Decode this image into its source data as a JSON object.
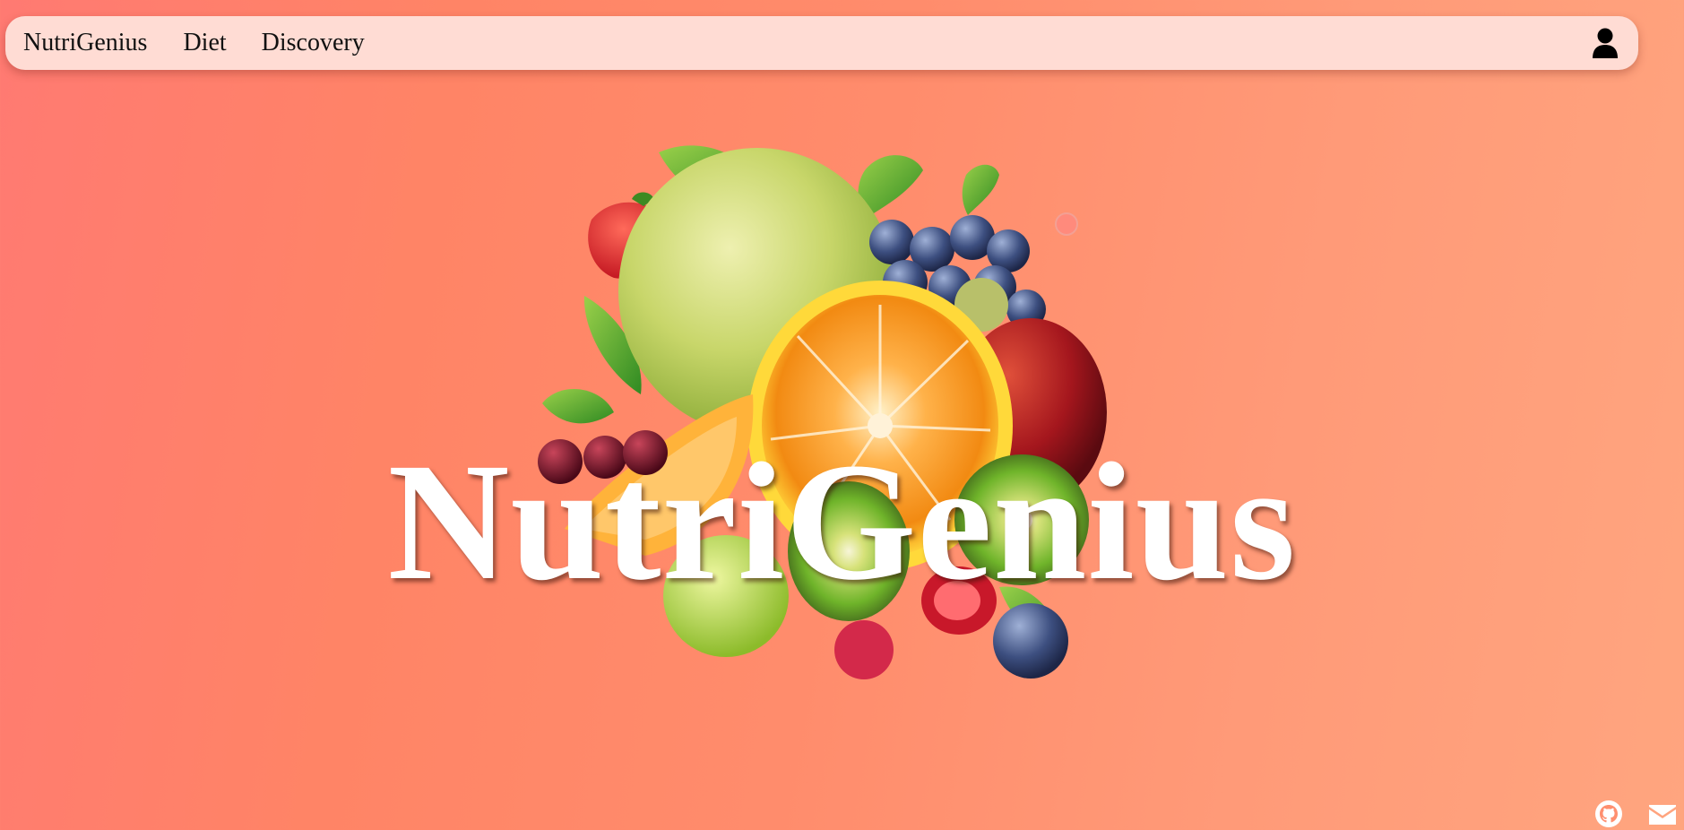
{
  "nav": {
    "brand": "NutriGenius",
    "links": [
      "Diet",
      "Discovery"
    ],
    "user_icon": "user-icon"
  },
  "hero": {
    "title": "NutriGenius",
    "image": "fruit-collage"
  },
  "footer": {
    "icons": [
      "github-icon",
      "mail-icon"
    ]
  },
  "colors": {
    "background_start": "#ff7a72",
    "background_end": "#ffa57f",
    "navbar": "#ffdcd4",
    "title": "#ffffff"
  }
}
